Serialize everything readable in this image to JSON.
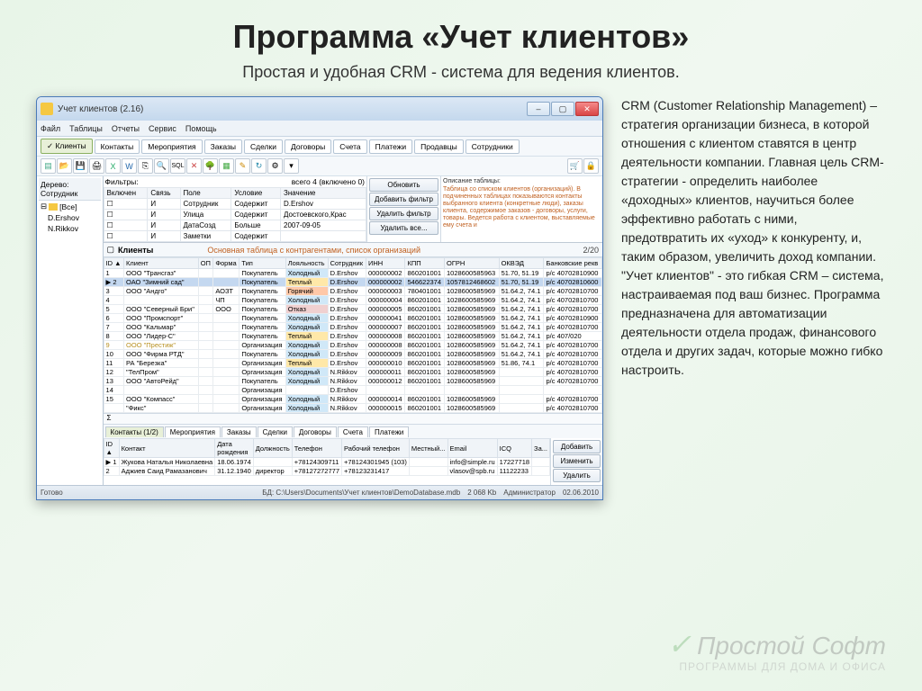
{
  "slide": {
    "title": "Программа «Учет клиентов»",
    "subtitle": "Простая и удобная CRM - система для ведения клиентов.",
    "description": "CRM (Customer Relationship Management) – стратегия организации бизнеса, в которой отношения с клиентом ставятся в центр деятельности компании. Главная цель CRM-стратегии - определить наиболее «доходных» клиентов, научиться более эффективно работать с ними, предотвратить их «уход» к конкуренту, и, таким образом, увеличить доход компании. \"Учет клиентов\" - это гибкая CRM – система, настраиваемая под ваш бизнес. Программа предназначена для автоматизации деятельности отдела продаж, финансового отдела и других задач, которые можно гибко настроить."
  },
  "watermark": {
    "brand": "Простой Софт",
    "tagline": "ПРОГРАММЫ ДЛЯ ДОМА И ОФИСА"
  },
  "window": {
    "title": "Учет клиентов (2.16)",
    "menu": [
      "Файл",
      "Таблицы",
      "Отчеты",
      "Сервис",
      "Помощь"
    ],
    "tabs": [
      "✓ Клиенты",
      "Контакты",
      "Мероприятия",
      "Заказы",
      "Сделки",
      "Договоры",
      "Счета",
      "Платежи",
      "Продавцы",
      "Сотрудники"
    ],
    "tree": {
      "header_label": "Дерево: Сотрудник",
      "root": "[Все]",
      "nodes": [
        "D.Ershov",
        "N.Rikkov"
      ]
    },
    "filters": {
      "label": "Фильтры:",
      "count_text": "всего 4 (включено 0)",
      "desc_label": "Описание таблицы:",
      "columns": [
        "Включен",
        "Связь",
        "Поле",
        "Условие",
        "Значение"
      ],
      "rows": [
        {
          "enabled": "☐",
          "rel": "И",
          "field": "Сотрудник",
          "cond": "Содержит",
          "value": "D.Ershov"
        },
        {
          "enabled": "☐",
          "rel": "И",
          "field": "Улица",
          "cond": "Содержит",
          "value": "Достоевского,Крас"
        },
        {
          "enabled": "☐",
          "rel": "И",
          "field": "ДатаСозд",
          "cond": "Больше",
          "value": "2007-09-05"
        },
        {
          "enabled": "☐",
          "rel": "И",
          "field": "Заметки",
          "cond": "Содержит",
          "value": ""
        }
      ],
      "buttons": {
        "refresh": "Обновить",
        "add": "Добавить фильтр",
        "del": "Удалить фильтр",
        "delall": "Удалить все..."
      },
      "description": "Таблица со списком клиентов (организаций). В подчиненных таблицах показываются контакты выбранного клиента (конкретные люди), заказы клиента, содержимое заказов - договоры, услуги, товары. Ведется работа с клиентом, выставляемые ему счета и"
    },
    "clients": {
      "title": "Клиенты",
      "subtitle": "Основная таблица с контрагентами, список организаций",
      "count": "2/20",
      "columns": [
        "ID ▲",
        "Клиент",
        "ОП",
        "Форма",
        "Тип",
        "Лояльность",
        "Сотрудник",
        "ИНН",
        "КПП",
        "ОГРН",
        "ОКВЭД",
        "Банковские рекв"
      ],
      "rows": [
        {
          "cells": [
            "1",
            "ООО \"Трансгаз\"",
            "",
            "",
            "Покупатель",
            "Холодный",
            "D.Ershov",
            "000000002",
            "860201001",
            "1028600585963",
            "51.70, 51.19",
            "р/с 40702810900"
          ]
        },
        {
          "cells": [
            "▶ 2",
            "ОАО \"Зимний сад\"",
            "",
            "",
            "Покупатель",
            "Теплый",
            "D.Ershov",
            "000000002",
            "546622374",
            "1057812468602",
            "51.70, 51.19",
            "р/с 40702810600"
          ],
          "sel": true,
          "warm": true
        },
        {
          "cells": [
            "3",
            "ООО \"Андго\"",
            "",
            "АОЗТ",
            "Покупатель",
            "Горячий",
            "D.Ershov",
            "000000003",
            "780401001",
            "1028600585969",
            "51.64.2, 74.1",
            "р/с 40702810700"
          ],
          "hot": true
        },
        {
          "cells": [
            "4",
            "",
            "",
            "ЧП",
            "Покупатель",
            "Холодный",
            "D.Ershov",
            "000000004",
            "860201001",
            "1028600585969",
            "51.64.2, 74.1",
            "р/с 40702810700"
          ],
          "cold": true
        },
        {
          "cells": [
            "5",
            "ООО \"Северный Бри\"",
            "",
            "ООО",
            "Покупатель",
            "Отказ",
            "D.Ershov",
            "000000005",
            "860201001",
            "1028600585969",
            "51.64.2, 74.1",
            "р/с 40702810700"
          ],
          "reject": true
        },
        {
          "cells": [
            "6",
            "ООО \"Промспорт\"",
            "",
            "",
            "Покупатель",
            "Холодный",
            "D.Ershov",
            "000000041",
            "860201001",
            "1028600585969",
            "51.64.2, 74.1",
            "р/с 40702810900"
          ]
        },
        {
          "cells": [
            "7",
            "ООО \"Кальмар\"",
            "",
            "",
            "Покупатель",
            "Холодный",
            "D.Ershov",
            "000000007",
            "860201001",
            "1028600585969",
            "51.64.2, 74.1",
            "р/с 40702810700"
          ]
        },
        {
          "cells": [
            "8",
            "ООО \"Лидер-С\"",
            "",
            "",
            "Покупатель",
            "Теплый",
            "D.Ershov",
            "000000008",
            "860201001",
            "1028600585969",
            "51.64.2, 74.1",
            "р/с 407/020"
          ]
        },
        {
          "cells": [
            "9",
            "ООО \"Престиж\"",
            "",
            "",
            "Организация",
            "Холодный",
            "D.Ershov",
            "000000008",
            "860201001",
            "1028600585969",
            "51.64.2, 74.1",
            "р/с 40702810700"
          ],
          "yellow": true
        },
        {
          "cells": [
            "10",
            "ООО \"Фирма РТД\"",
            "",
            "",
            "Покупатель",
            "Холодный",
            "D.Ershov",
            "000000009",
            "860201001",
            "1028600585969",
            "51.64.2, 74.1",
            "р/с 40702810700"
          ]
        },
        {
          "cells": [
            "11",
            "РА \"Березка\"",
            "",
            "",
            "Организация",
            "Теплый",
            "D.Ershov",
            "000000010",
            "860201001",
            "1028600585969",
            "51.86, 74.1",
            "р/с 40702810700"
          ]
        },
        {
          "cells": [
            "12",
            "\"ТелПром\"",
            "",
            "",
            "Организация",
            "Холодный",
            "N.Rikkov",
            "000000011",
            "860201001",
            "1028600585969",
            "",
            "р/с 40702810700"
          ]
        },
        {
          "cells": [
            "13",
            "ООО \"АвтоРейд\"",
            "",
            "",
            "Покупатель",
            "Холодный",
            "N.Rikkov",
            "000000012",
            "860201001",
            "1028600585969",
            "",
            "р/с 40702810700"
          ]
        },
        {
          "cells": [
            "14",
            "",
            "",
            "",
            "Организация",
            "",
            "D.Ershov",
            "",
            "",
            "",
            "",
            ""
          ]
        },
        {
          "cells": [
            "15",
            "ООО \"Компасс\"",
            "",
            "",
            "Организация",
            "Холодный",
            "N.Rikkov",
            "000000014",
            "860201001",
            "1028600585969",
            "",
            "р/с 40702810700"
          ]
        },
        {
          "cells": [
            "",
            "\"Фикс\"",
            "",
            "",
            "Организация",
            "Холодный",
            "N.Rikkov",
            "000000015",
            "860201001",
            "1028600585969",
            "",
            "р/с 40702810700"
          ]
        }
      ],
      "sum": "Σ"
    },
    "subtabs": [
      "Контакты (1/2)",
      "Мероприятия",
      "Заказы",
      "Сделки",
      "Договоры",
      "Счета",
      "Платежи"
    ],
    "contacts": {
      "columns": [
        "ID ▲",
        "Контакт",
        "Дата рождения",
        "Должность",
        "Телефон",
        "Рабочий телефон",
        "Местный...",
        "Email",
        "ICQ",
        "За..."
      ],
      "rows": [
        {
          "cells": [
            "▶ 1",
            "Жукова Наталья Николаевна",
            "18.06.1974",
            "",
            "+78124309711",
            "+78124301945 (103)",
            "",
            "info@simple.ru",
            "17227718",
            ""
          ],
          "sel": true
        },
        {
          "cells": [
            "2",
            "Аджиев Саид Рамазанович",
            "31.12.1940",
            "директор",
            "+78127272777",
            "+78123231417",
            "",
            "vlasov@spb.ru",
            "11122233",
            ""
          ]
        }
      ],
      "buttons": {
        "add": "Добавить",
        "edit": "Изменить",
        "del": "Удалить"
      }
    },
    "statusbar": {
      "ready": "Готово",
      "db": "БД: C:\\Users\\Documents\\Учет клиентов\\DemoDatabase.mdb",
      "size": "2 068 Kb",
      "user": "Администратор",
      "date": "02.06.2010"
    }
  }
}
